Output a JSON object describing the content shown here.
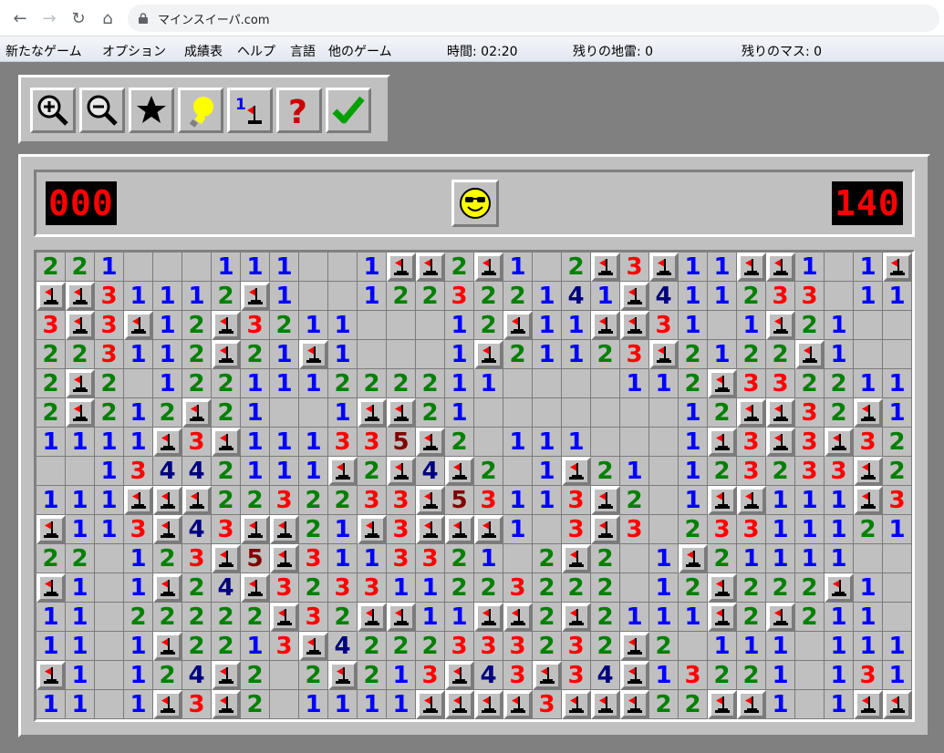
{
  "browser": {
    "url": "マインスイーパ.com",
    "icons": [
      "back-icon",
      "forward-icon",
      "reload-icon",
      "home-icon",
      "lock-icon"
    ]
  },
  "menu": {
    "items": [
      "新たなゲーム",
      "オプション",
      "成績表",
      "ヘルプ",
      "言語",
      "他のゲーム"
    ],
    "time": "時間: 02:20",
    "mines_left": "残りの地雷: 0",
    "cells_left": "残りのマス: 0"
  },
  "toolbar": {
    "tools": [
      "zoom-in-icon",
      "zoom-out-icon",
      "star-icon",
      "hint-lightbulb-icon",
      "numbers-flag-icon",
      "help-question-icon",
      "check-icon"
    ]
  },
  "game": {
    "mine_counter": "000",
    "timer": "140",
    "smiley_state": "sunglasses",
    "colors": {
      "1": "#0000ff",
      "2": "#008000",
      "3": "#ff0000",
      "4": "#000080",
      "5": "#800000"
    },
    "board": [
      "221...111..1FF2F1.2F3F11FF1.1F",
      "FF3111 2F1..122322141F411233 .11",
      "3F3F12F3211...12F11FF31.1F21...",
      "223112F21F1...1F2112 3F212 2F1...",
      "2F2.12211122221 1....112F33221 1.",
      "2F212F21..1FF21.......12FF32F1.",
      "1111F3F11133 5F2.111...1F3F3F32.",
      "..13442111F2F4F2.1F21.1232 33F21",
      "111FFF2232233F53113F2.1FF111F3F1",
      "F113F43FF21F3FFF1.3F3.233111211",
      "22.123F5F3113321.2F2.1F21111..",
      "F1.1F24F3233112232 22.12F222F1.",
      "11.22222F32FF11FF2F2111F2F211.",
      "11.1F2213F4222333232F2.111.111",
      "F1.124F2.2F213F4 3F34F1322 1.1312",
      "11.1F3F2.1111FFFF3FFF22FF1.1FF2"
    ]
  }
}
